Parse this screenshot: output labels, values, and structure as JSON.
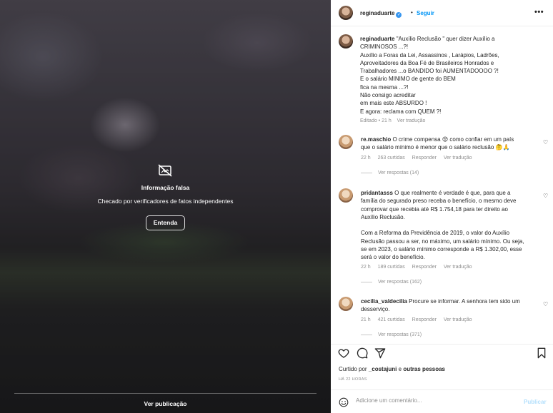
{
  "media": {
    "title": "Informação falsa",
    "subtitle": "Checado por verificadores de fatos independentes",
    "button": "Entenda",
    "see_post": "Ver publicação"
  },
  "header": {
    "username": "reginaduarte",
    "dot": "•",
    "follow": "Seguir",
    "more": "•••"
  },
  "caption": {
    "username": "reginaduarte",
    "text": " \"Auxílio Reclusão \" quer dizer Auxílio a\nCRIMINOSOS ...?!\nAuxílio a Foras da Lei, Assassinos , Larápios, Ladrões,\nAproveitadores da Boa Fé de Brasileiros Honrados e\nTrabalhadores ...o BANDIDO foi AUMENTADOOOO ?!\nE o salário MINIMO de gente do BEM\nfica na mesma ...?!\nNão consigo acreditar\nem mais este ABSURDO !\nE agora: reclama com QUEM ?!",
    "edited": "Editado • 21 h",
    "translate": "Ver tradução"
  },
  "comments": [
    {
      "username": "re.maschio",
      "text": "O crime compensa 😡 como confiar em um país\nque o salário mínimo é menor que o salário reclusão 🤔🙏",
      "time": "22 h",
      "likes": "263 curtidas",
      "reply": "Responder",
      "translate": "Ver tradução",
      "replies": "Ver respostas (14)"
    },
    {
      "username": "pridantasss",
      "text": "O que realmente é verdade é que, para que a\nfamília do segurado preso receba o benefício, o mesmo deve\ncomprovar que recebia até R$ 1.754,18 para ter direito ao\nAuxílio Reclusão.\n\nCom a Reforma da Previdência de 2019, o valor do Auxílio\nReclusão passou a ser, no máximo, um salário mínimo. Ou seja,\nse em 2023, o salário mínimo corresponde a R$ 1.302,00, esse\nserá o valor do benefício.",
      "time": "22 h",
      "likes": "189 curtidas",
      "reply": "Responder",
      "translate": "Ver tradução",
      "replies": "Ver respostas (162)"
    },
    {
      "username": "cecilia_valdecilia",
      "text": "Procure se informar. A senhora tem sido um\ndesserviço.",
      "time": "21 h",
      "likes": "421 curtidas",
      "reply": "Responder",
      "translate": "Ver tradução",
      "replies": "Ver respostas (371)"
    }
  ],
  "liked_by": {
    "prefix": "Curtido por",
    "user": "_costajuni",
    "conj": "e",
    "others": "outras pessoas"
  },
  "post_time": "HÁ 22 HORAS",
  "composer": {
    "placeholder": "Adicione um comentário...",
    "publish": "Publicar"
  },
  "colors": {
    "accent": "#0095f6",
    "verified": "#3897f0",
    "muted": "#8e8e8e"
  }
}
